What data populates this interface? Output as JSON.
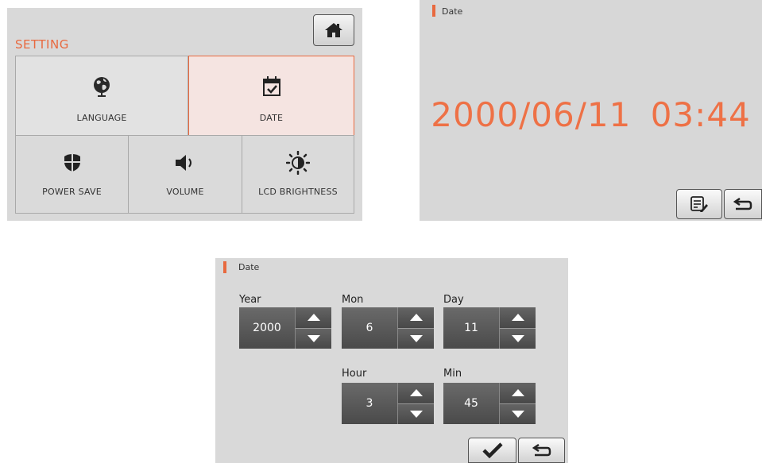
{
  "setting_screen": {
    "title": "SETTING",
    "tiles": {
      "language": "LANGUAGE",
      "date": "DATE",
      "power_save": "POWER SAVE",
      "volume": "VOLUME",
      "lcd_brightness": "LCD BRIGHTNESS"
    },
    "selected_tile": "date",
    "icons": [
      "home-icon",
      "globe-icon",
      "calendar-check-icon",
      "shield-icon",
      "speaker-icon",
      "brightness-icon"
    ]
  },
  "date_display_screen": {
    "header": "Date",
    "datetime": "2000/06/11  03:44",
    "icons": [
      "edit-list-icon",
      "return-arrow-icon"
    ]
  },
  "date_edit_screen": {
    "header": "Date",
    "fields": {
      "year": {
        "label": "Year",
        "value": "2000"
      },
      "month": {
        "label": "Mon",
        "value": "6"
      },
      "day": {
        "label": "Day",
        "value": "11"
      },
      "hour": {
        "label": "Hour",
        "value": "3"
      },
      "min": {
        "label": "Min",
        "value": "45"
      }
    },
    "icons": [
      "checkmark-icon",
      "return-arrow-icon"
    ]
  },
  "colors": {
    "accent": "#e8693f",
    "selected_tile_bg": "#f5e4e1",
    "panel_bg": "#d9d9d9",
    "spinner_bg": "#555555"
  }
}
